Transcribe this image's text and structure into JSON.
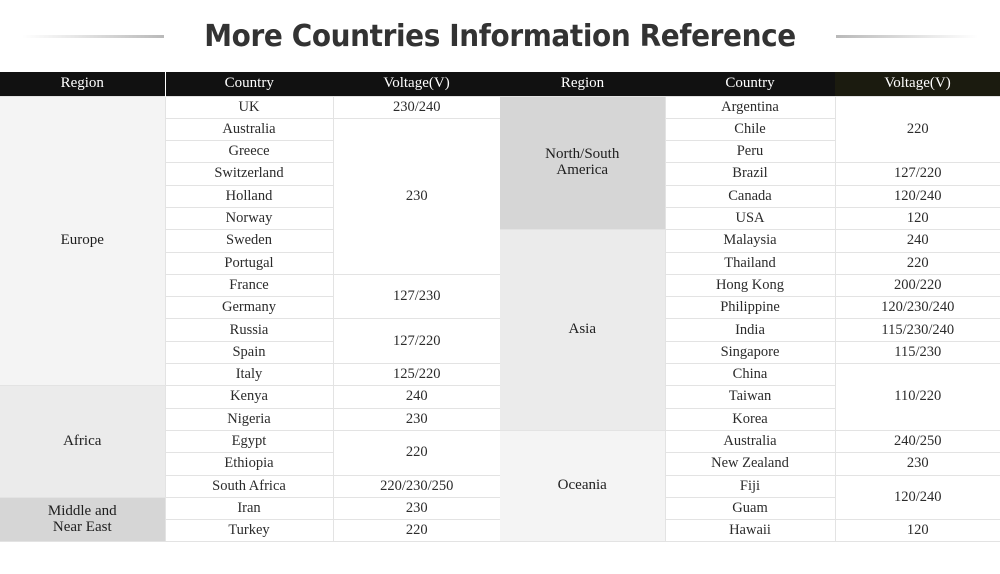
{
  "page": {
    "title": "More Countries Information Reference"
  },
  "columns": {
    "region": "Region",
    "country": "Country",
    "voltage": "Voltage(V)"
  },
  "colors": {
    "header_bg": "#111111",
    "header_accent_bg": "#1b1b0f",
    "header_text": "#ffffff",
    "title_text": "#333333",
    "grid_line": "#e3e3e3",
    "shade_light": "#f4f4f4",
    "shade_mid": "#ebebeb",
    "shade_dark": "#d6d6d6"
  },
  "left_table": {
    "regions": [
      {
        "name": "Europe",
        "rows": 13,
        "shade": "shade-a"
      },
      {
        "name": "Africa",
        "rows": 5,
        "shade": "shade-b"
      },
      {
        "name": "Middle and\nNear East",
        "label_line1": "Middle and",
        "label_line2": "Near East",
        "rows": 2,
        "shade": "shade-c"
      }
    ],
    "countries": [
      "UK",
      "Australia",
      "Greece",
      "Switzerland",
      "Holland",
      "Norway",
      "Sweden",
      "Portugal",
      "France",
      "Germany",
      "Russia",
      "Spain",
      "Italy",
      "Kenya",
      "Nigeria",
      "Egypt",
      "Ethiopia",
      "South Africa",
      "Iran",
      "Turkey"
    ],
    "voltage_groups": [
      {
        "value": "230/240",
        "span": 1
      },
      {
        "value": "230",
        "span": 7
      },
      {
        "value": "127/230",
        "span": 2
      },
      {
        "value": "127/220",
        "span": 2
      },
      {
        "value": "125/220",
        "span": 1
      },
      {
        "value": "240",
        "span": 1
      },
      {
        "value": "230",
        "span": 1
      },
      {
        "value": "220",
        "span": 2
      },
      {
        "value": "220/230/250",
        "span": 1
      },
      {
        "value": "230",
        "span": 1
      },
      {
        "value": "220",
        "span": 1
      }
    ]
  },
  "right_table": {
    "regions": [
      {
        "name": "North/South America",
        "label_line1": "North/South",
        "label_line2": "America",
        "rows": 6,
        "shade": "shade-c"
      },
      {
        "name": "Asia",
        "rows": 9,
        "shade": "shade-b"
      },
      {
        "name": "Oceania",
        "rows": 5,
        "shade": "shade-a"
      }
    ],
    "countries": [
      "Argentina",
      "Chile",
      "Peru",
      "Brazil",
      "Canada",
      "USA",
      "Malaysia",
      "Thailand",
      "Hong Kong",
      "Philippine",
      "India",
      "Singapore",
      "China",
      "Taiwan",
      "Korea",
      "Australia",
      "New Zealand",
      "Fiji",
      "Guam",
      "Hawaii"
    ],
    "voltage_groups": [
      {
        "value": "220",
        "span": 3
      },
      {
        "value": "127/220",
        "span": 1
      },
      {
        "value": "120/240",
        "span": 1
      },
      {
        "value": "120",
        "span": 1
      },
      {
        "value": "240",
        "span": 1
      },
      {
        "value": "220",
        "span": 1
      },
      {
        "value": "200/220",
        "span": 1
      },
      {
        "value": "120/230/240",
        "span": 1
      },
      {
        "value": "115/230/240",
        "span": 1
      },
      {
        "value": "115/230",
        "span": 1
      },
      {
        "value": "110/220",
        "span": 3
      },
      {
        "value": "240/250",
        "span": 1
      },
      {
        "value": "230",
        "span": 1
      },
      {
        "value": "120/240",
        "span": 2
      },
      {
        "value": "120",
        "span": 1
      }
    ]
  }
}
